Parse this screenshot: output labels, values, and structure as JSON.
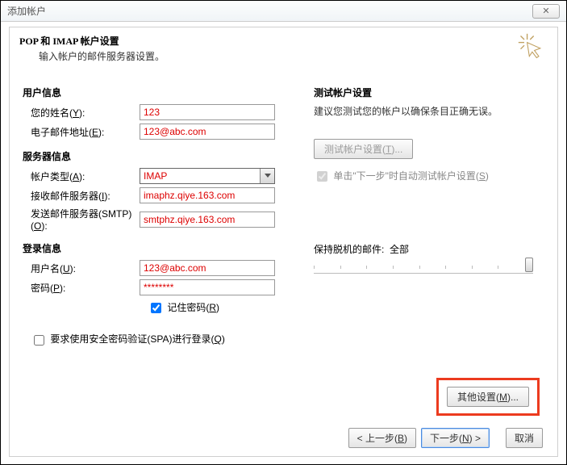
{
  "window": {
    "title": "添加帐户",
    "close": "✕"
  },
  "header": {
    "title": "POP 和 IMAP 帐户设置",
    "subtitle": "输入帐户的邮件服务器设置。"
  },
  "left": {
    "user_info_section": "用户信息",
    "name_label": "您的姓名(Y):",
    "name_key": "Y",
    "name_value": "123",
    "email_label": "电子邮件地址(E):",
    "email_key": "E",
    "email_value": "123@abc.com",
    "server_info_section": "服务器信息",
    "acct_type_label": "帐户类型(A):",
    "acct_type_key": "A",
    "acct_type_value": "IMAP",
    "incoming_label": "接收邮件服务器(I):",
    "incoming_key": "I",
    "incoming_value": "imaphz.qiye.163.com",
    "outgoing_label": "发送邮件服务器(SMTP)(O):",
    "outgoing_key": "O",
    "outgoing_value": "smtphz.qiye.163.com",
    "login_section": "登录信息",
    "username_label": "用户名(U):",
    "username_key": "U",
    "username_value": "123@abc.com",
    "password_label": "密码(P):",
    "password_key": "P",
    "password_value": "********",
    "remember_label": "记住密码(R)",
    "remember_key": "R",
    "spa_label": "要求使用安全密码验证(SPA)进行登录(Q)",
    "spa_key": "Q"
  },
  "right": {
    "test_section": "测试帐户设置",
    "test_desc": "建议您测试您的帐户以确保条目正确无误。",
    "test_button": "测试帐户设置(T)...",
    "test_key": "T",
    "auto_test_label": "单击\"下一步\"时自动测试帐户设置(S)",
    "auto_test_key": "S",
    "offline_label": "保持脱机的邮件:",
    "offline_value": "全部",
    "more_button": "其他设置(M)...",
    "more_key": "M"
  },
  "footer": {
    "back": "< 上一步(B)",
    "back_key": "B",
    "next": "下一步(N) >",
    "next_key": "N",
    "cancel": "取消"
  }
}
